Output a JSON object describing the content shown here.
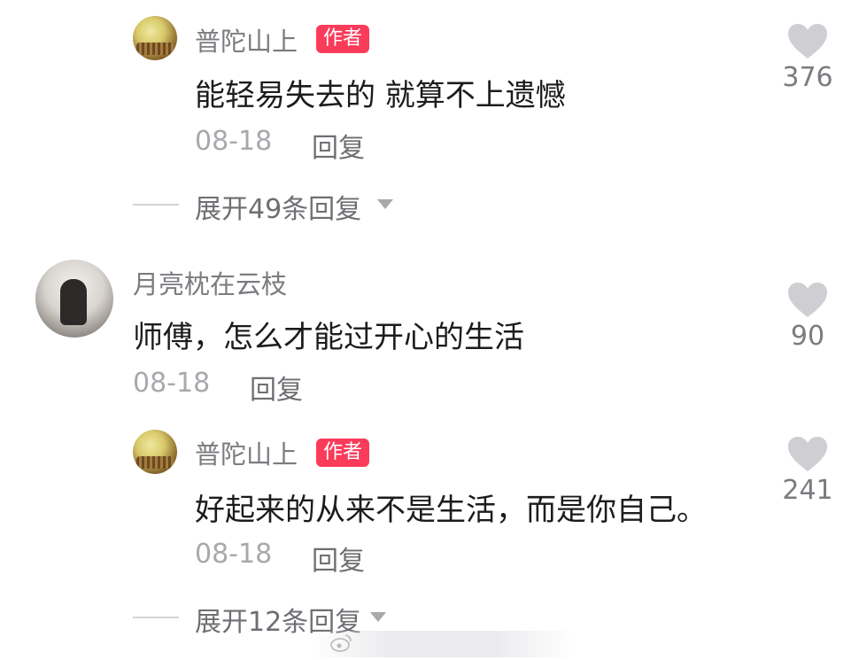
{
  "comments": [
    {
      "name": "普陀山上",
      "tag": "作者",
      "text": "能轻易失去的 就算不上遗憾",
      "date": "08-18",
      "reply_label": "回复",
      "likes": "376",
      "expand_label": "展开49条回复"
    },
    {
      "name": "月亮枕在云枝",
      "text": "师傅，怎么才能过开心的生活",
      "date": "08-18",
      "reply_label": "回复",
      "likes": "90"
    },
    {
      "name": "普陀山上",
      "tag": "作者",
      "text": "好起来的从来不是生活，而是你自己。",
      "date": "08-18",
      "reply_label": "回复",
      "likes": "241",
      "expand_label": "展开12条回复"
    }
  ],
  "colors": {
    "author_tag": "#fb3b5a",
    "heart": "#cfcfd3",
    "muted_text": "#7b7b80"
  },
  "icons": {
    "like": "heart-icon",
    "expand": "chevron-down-icon"
  }
}
